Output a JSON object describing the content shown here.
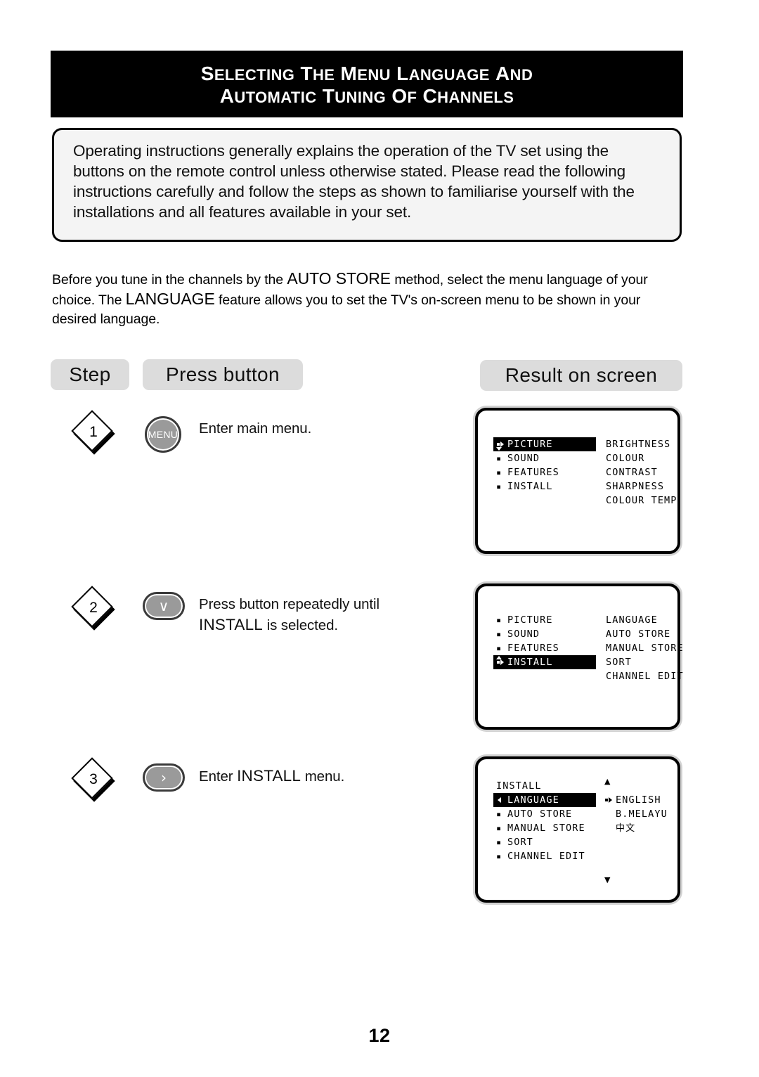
{
  "header": {
    "title_line1_parts": [
      {
        "t": "S",
        "caps": true
      },
      {
        "t": "ELECTING",
        "caps": false
      },
      {
        "t": " T",
        "caps": true
      },
      {
        "t": "HE",
        "caps": false
      },
      {
        "t": " M",
        "caps": true
      },
      {
        "t": "ENU",
        "caps": false
      },
      {
        "t": " L",
        "caps": true
      },
      {
        "t": "ANGUAGE",
        "caps": false
      },
      {
        "t": " A",
        "caps": true
      },
      {
        "t": "ND",
        "caps": false
      }
    ],
    "title_line1": "SELECTING THE MENU LANGUAGE AND",
    "title_line2": "AUTOMATIC TUNING OF CHANNELS"
  },
  "intro": {
    "text": "Operating instructions generally explains the operation of the TV set using the buttons on the remote control unless otherwise stated. Please read the following instructions carefully and follow the steps as shown to familiarise yourself with the installations and all features available in your set."
  },
  "body_paragraph": {
    "part1": "Before you tune in the channels by the ",
    "emphasis1": "AUTO STORE",
    "part2": " method, select the menu language of your choice. The ",
    "emphasis2": "LANGUAGE",
    "part3": " feature allows you to set the TV's on-screen menu to be shown in your desired language."
  },
  "column_headers": {
    "step": "Step",
    "press_button": "Press button",
    "result_on_screen": "Result on screen"
  },
  "steps": [
    {
      "number": "1",
      "button_label": "MENU",
      "button_type": "round",
      "description": "Enter main menu."
    },
    {
      "number": "2",
      "button_label": "∨",
      "button_type": "pill",
      "description_line1": "Press button repeatedly until",
      "description_caps": "INSTALL",
      "description_line2": " is selected."
    },
    {
      "number": "3",
      "button_label": "›",
      "button_type": "pill",
      "description_pre": "Enter ",
      "description_caps": "INSTALL",
      "description_post": " menu."
    }
  ],
  "screens": [
    {
      "title": null,
      "left_items": [
        {
          "label": "PICTURE",
          "selected": true,
          "cursor": "sq-right-down"
        },
        {
          "label": "SOUND",
          "selected": false,
          "cursor": "bullet"
        },
        {
          "label": "FEATURES",
          "selected": false,
          "cursor": "bullet"
        },
        {
          "label": "INSTALL",
          "selected": false,
          "cursor": "bullet"
        }
      ],
      "right_items": [
        "BRIGHTNESS",
        "COLOUR",
        "CONTRAST",
        "SHARPNESS",
        "COLOUR TEMP"
      ],
      "scroll_up": false,
      "scroll_down": false
    },
    {
      "title": null,
      "left_items": [
        {
          "label": "PICTURE",
          "selected": false,
          "cursor": "bullet"
        },
        {
          "label": "SOUND",
          "selected": false,
          "cursor": "bullet"
        },
        {
          "label": "FEATURES",
          "selected": false,
          "cursor": "bullet"
        },
        {
          "label": "INSTALL",
          "selected": true,
          "cursor": "sq-right-up"
        }
      ],
      "right_items": [
        "LANGUAGE",
        "AUTO STORE",
        "MANUAL STORE",
        "SORT",
        "CHANNEL EDIT"
      ],
      "scroll_up": false,
      "scroll_down": false
    },
    {
      "title": "INSTALL",
      "left_items": [
        {
          "label": "LANGUAGE",
          "selected": true,
          "cursor": "left"
        },
        {
          "label": "AUTO STORE",
          "selected": false,
          "cursor": "bullet"
        },
        {
          "label": "MANUAL STORE",
          "selected": false,
          "cursor": "bullet"
        },
        {
          "label": "SORT",
          "selected": false,
          "cursor": "bullet"
        },
        {
          "label": "CHANNEL EDIT",
          "selected": false,
          "cursor": "bullet"
        }
      ],
      "right_items_detail": [
        {
          "label": "ENGLISH",
          "cursor": "sq-right"
        },
        {
          "label": "B.MELAYU",
          "cursor": "none"
        },
        {
          "label": "中文",
          "cursor": "none",
          "cjk": true
        }
      ],
      "scroll_up": "▲",
      "scroll_down": "▼"
    }
  ],
  "page_number": "12",
  "colors": {
    "title_bar_bg": "#000000",
    "title_bar_text": "#ffffff",
    "pill_bg": "#dcdcdc",
    "button_face": "#9a9a9a",
    "button_ring": "#3a3a3a",
    "osd_highlight_bg": "#000000",
    "osd_highlight_text": "#ffffff",
    "intro_box_bg": "#f4f4f4"
  }
}
